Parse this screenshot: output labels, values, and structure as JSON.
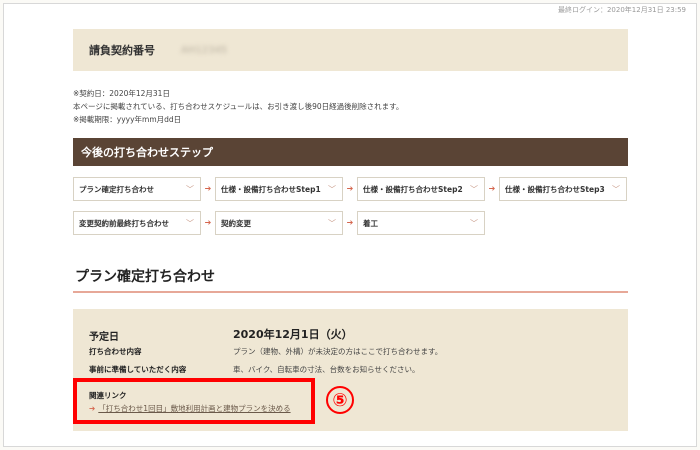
{
  "header": {
    "last_login": "最終ログイン：2020年12月31日 23:59"
  },
  "contract": {
    "label": "請負契約番号",
    "number": "AH12345"
  },
  "notes": [
    "※契約日：2020年12月31日",
    "本ページに掲載されている、打ち合わせスケジュールは、お引き渡し後90日経過後削除されます。",
    "※掲載期限：yyyy年mm月dd日"
  ],
  "steps": {
    "title": "今後の打ち合わせステップ",
    "items": [
      {
        "label": "プラン確定打ち合わせ"
      },
      {
        "label": "仕様・設備打ち合わせStep1"
      },
      {
        "label": "仕様・設備打ち合わせStep2"
      },
      {
        "label": "仕様・設備打ち合わせStep3"
      },
      {
        "label": "変更契約前最終打ち合わせ"
      },
      {
        "label": "契約変更"
      },
      {
        "label": "着工"
      }
    ],
    "chevron": "﹀",
    "arrow": "➔"
  },
  "section": {
    "title": "プラン確定打ち合わせ",
    "date_label": "予定日",
    "date_value": "2020年12月1日（火）",
    "content_label": "打ち合わせ内容",
    "content_value": "プラン（建物、外構）が未決定の方はここで打ち合わせます。",
    "prep_label": "事前に準備していただく内容",
    "prep_value": "車、バイク、自転車の寸法、台数をお知らせください。",
    "related_label": "関連リンク",
    "related_link": "「打ち合わせ1回目」敷地利用計画と建物プランを決める"
  },
  "annotation": {
    "callout": "⑤",
    "color": "#ff0000"
  }
}
